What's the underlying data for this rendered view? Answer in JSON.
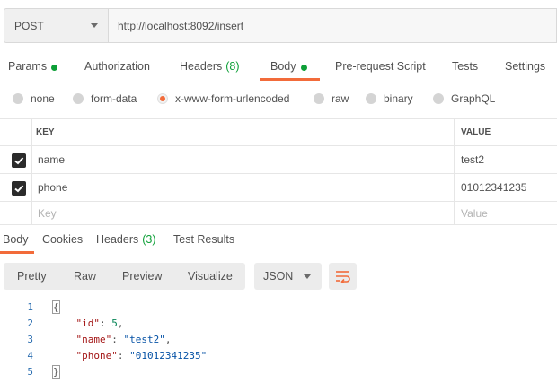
{
  "request": {
    "method": "POST",
    "url": "http://localhost:8092/insert"
  },
  "request_tabs": [
    {
      "label": "Params",
      "dot": true
    },
    {
      "label": "Authorization"
    },
    {
      "label": "Headers",
      "count": "(8)"
    },
    {
      "label": "Body",
      "dot": true,
      "active": true
    },
    {
      "label": "Pre-request Script"
    },
    {
      "label": "Tests"
    },
    {
      "label": "Settings"
    }
  ],
  "body_types": [
    {
      "label": "none"
    },
    {
      "label": "form-data"
    },
    {
      "label": "x-www-form-urlencoded",
      "selected": true
    },
    {
      "label": "raw"
    },
    {
      "label": "binary"
    },
    {
      "label": "GraphQL"
    }
  ],
  "params_table": {
    "headers": {
      "key": "KEY",
      "value": "VALUE"
    },
    "rows": [
      {
        "key": "name",
        "value": "test2",
        "checked": true
      },
      {
        "key": "phone",
        "value": "01012341235",
        "checked": true
      }
    ],
    "placeholder": {
      "key": "Key",
      "value": "Value"
    }
  },
  "response_tabs": [
    {
      "label": "Body",
      "active": true
    },
    {
      "label": "Cookies"
    },
    {
      "label": "Headers",
      "count": "(3)"
    },
    {
      "label": "Test Results"
    }
  ],
  "response_toolbar": {
    "views": [
      "Pretty",
      "Raw",
      "Preview",
      "Visualize"
    ],
    "format": "JSON",
    "wrap_icon": "wrap-lines-icon"
  },
  "response_body": {
    "line_numbers": [
      "1",
      "2",
      "3",
      "4",
      "5"
    ],
    "open_brace": "{",
    "close_brace": "}",
    "fields": [
      {
        "key": "\"id\"",
        "sep": ": ",
        "value": "5",
        "comma": ","
      },
      {
        "key": "\"name\"",
        "sep": ": ",
        "value": "\"test2\"",
        "comma": ","
      },
      {
        "key": "\"phone\"",
        "sep": ": ",
        "value": "\"01012341235\"",
        "comma": ""
      }
    ]
  },
  "colors": {
    "accent": "#f26b3a",
    "status_green": "#0d9f37",
    "json_key": "#a31515",
    "json_string": "#0451a5",
    "json_number": "#098658"
  }
}
